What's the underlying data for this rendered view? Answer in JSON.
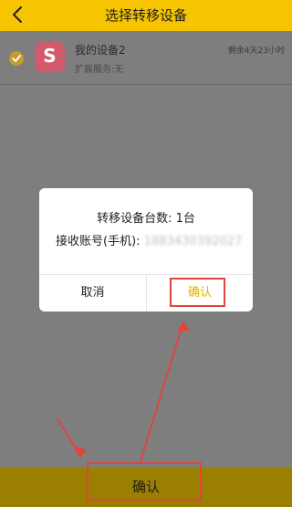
{
  "header": {
    "title": "选择转移设备",
    "back_icon": "chevron-left-icon"
  },
  "device": {
    "name": "我的设备2",
    "subtitle": "扩展服务:无",
    "remaining": "剩余4天23小时",
    "app_letter": "S",
    "selected": true
  },
  "dialog": {
    "line1": "转移设备台数: 1台",
    "line2_label": "接收账号(手机):",
    "line2_value": "1883430392027",
    "cancel_label": "取消",
    "confirm_label": "确认"
  },
  "bottom": {
    "confirm_label": "确认"
  },
  "colors": {
    "accent": "#f6c400",
    "confirm_text": "#e0b000",
    "annotation": "#e0443e"
  }
}
